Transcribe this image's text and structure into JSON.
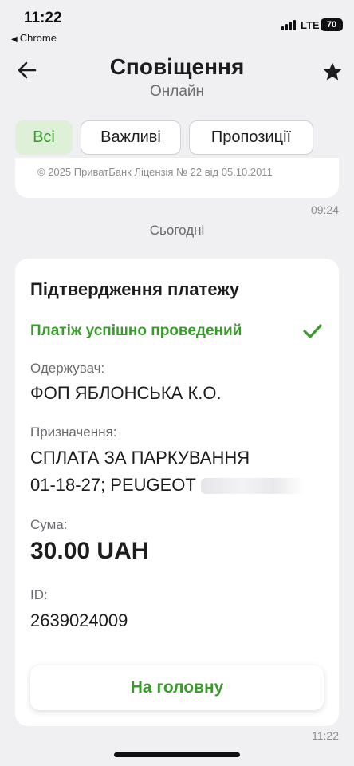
{
  "status_bar": {
    "time": "11:22",
    "back_app": "Chrome",
    "network": "LTE",
    "battery": "70"
  },
  "header": {
    "title": "Сповіщення",
    "subtitle": "Онлайн"
  },
  "filters": [
    {
      "label": "Всі",
      "active": true
    },
    {
      "label": "Важливі",
      "active": false
    },
    {
      "label": "Пропозиції",
      "active": false
    }
  ],
  "previous_message": {
    "footer": "© 2025 ПриватБанк Ліцензія № 22 від 05.10.2011",
    "time": "09:24"
  },
  "date_separator": "Сьогодні",
  "payment_card": {
    "title": "Підтвердження платежу",
    "status": "Платіж успішно проведений",
    "recipient_label": "Одержувач:",
    "recipient": "ФОП ЯБЛОНСЬКА К.О.",
    "purpose_label": "Призначення:",
    "purpose_line1": "СПЛАТА ЗА ПАРКУВАННЯ",
    "purpose_line2": "01-18-27; PEUGEOT",
    "amount_label": "Сума:",
    "amount": "30.00 UAH",
    "id_label": "ID:",
    "id": "2639024009",
    "home_button": "На головну",
    "time": "11:22"
  },
  "colors": {
    "accent_green": "#3b9a2e",
    "chip_active_bg": "#dff0d8",
    "background": "#f0f0f2"
  }
}
